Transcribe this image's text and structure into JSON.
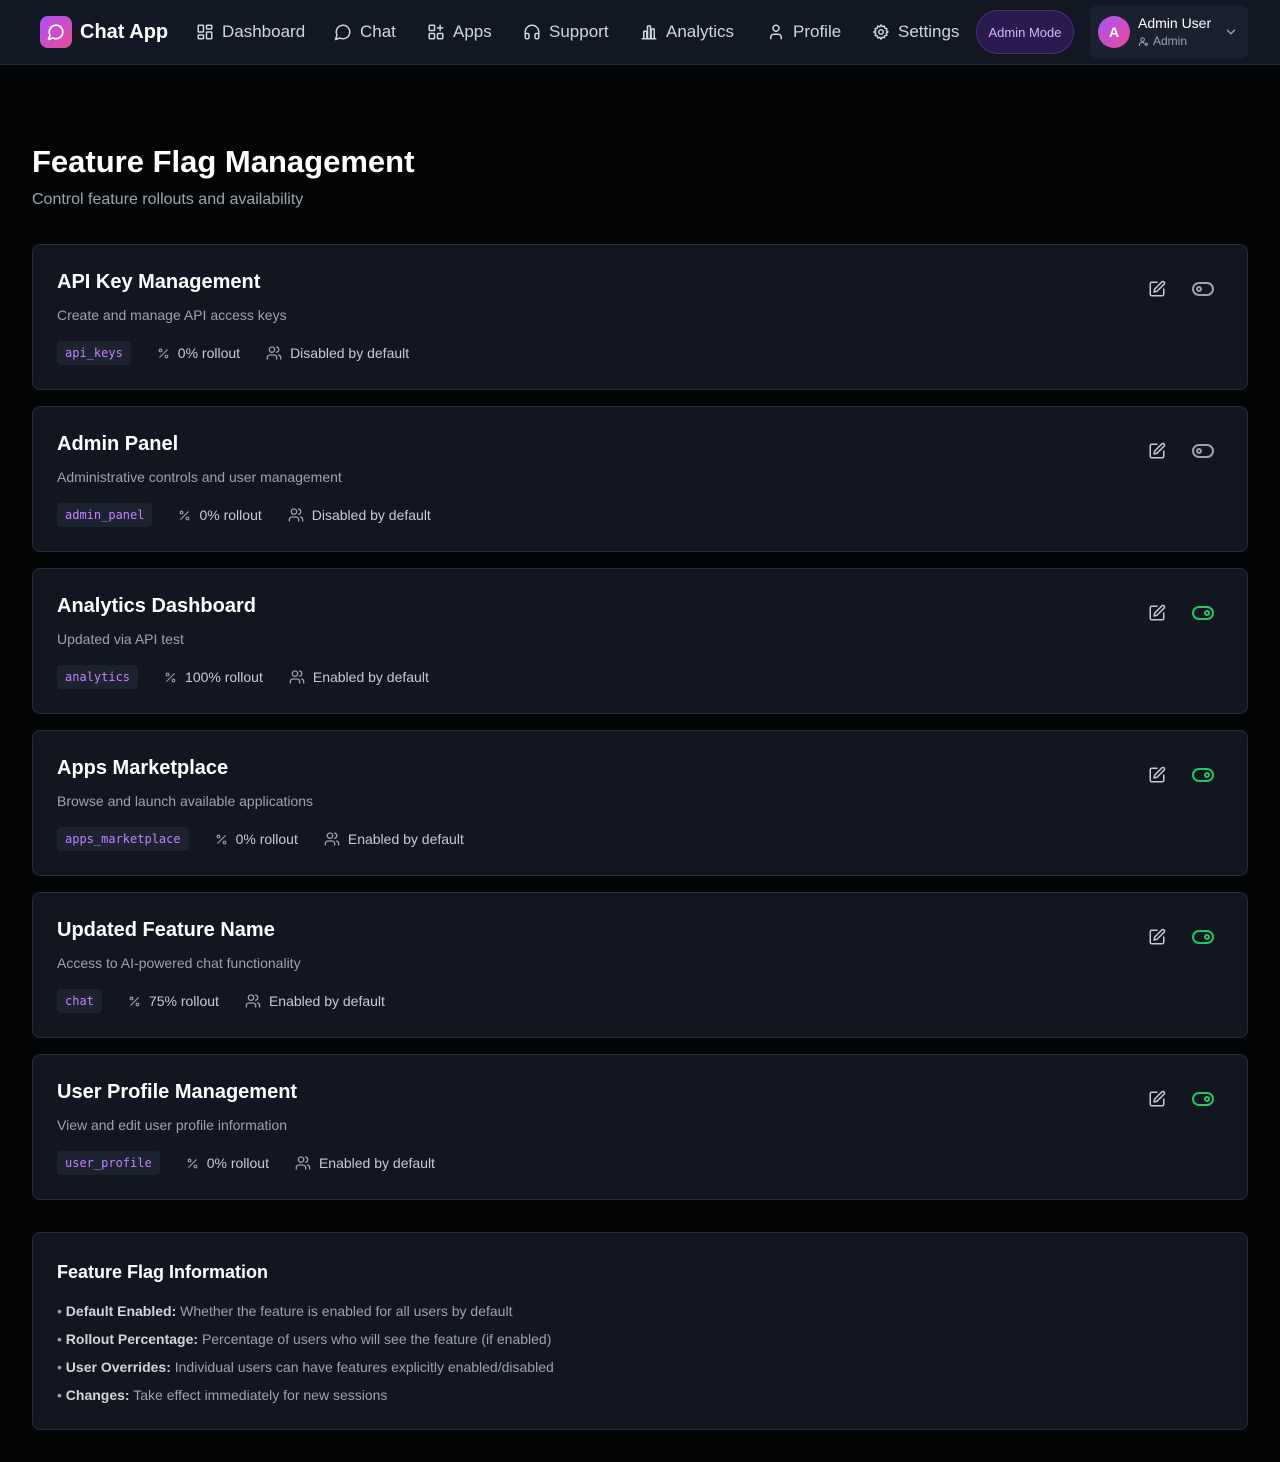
{
  "app": {
    "name": "Chat App",
    "admin_mode_label": "Admin Mode"
  },
  "nav": {
    "items": [
      {
        "label": "Dashboard",
        "icon": "dashboard-grid-icon"
      },
      {
        "label": "Chat",
        "icon": "chat-bubble-icon"
      },
      {
        "label": "Apps",
        "icon": "apps-icon"
      },
      {
        "label": "Support",
        "icon": "headset-icon"
      },
      {
        "label": "Analytics",
        "icon": "bar-chart-icon"
      },
      {
        "label": "Profile",
        "icon": "user-icon"
      },
      {
        "label": "Settings",
        "icon": "gear-icon"
      }
    ]
  },
  "user": {
    "initial": "A",
    "name": "Admin User",
    "role": "Admin"
  },
  "page": {
    "title": "Feature Flag Management",
    "subtitle": "Control feature rollouts and availability"
  },
  "flags": [
    {
      "name": "API Key Management",
      "description": "Create and manage API access keys",
      "key": "api_keys",
      "rollout": "0% rollout",
      "default": "Disabled by default",
      "enabled": false
    },
    {
      "name": "Admin Panel",
      "description": "Administrative controls and user management",
      "key": "admin_panel",
      "rollout": "0% rollout",
      "default": "Disabled by default",
      "enabled": false
    },
    {
      "name": "Analytics Dashboard",
      "description": "Updated via API test",
      "key": "analytics",
      "rollout": "100% rollout",
      "default": "Enabled by default",
      "enabled": true
    },
    {
      "name": "Apps Marketplace",
      "description": "Browse and launch available applications",
      "key": "apps_marketplace",
      "rollout": "0% rollout",
      "default": "Enabled by default",
      "enabled": true
    },
    {
      "name": "Updated Feature Name",
      "description": "Access to AI-powered chat functionality",
      "key": "chat",
      "rollout": "75% rollout",
      "default": "Enabled by default",
      "enabled": true
    },
    {
      "name": "User Profile Management",
      "description": "View and edit user profile information",
      "key": "user_profile",
      "rollout": "0% rollout",
      "default": "Enabled by default",
      "enabled": true
    }
  ],
  "info": {
    "title": "Feature Flag Information",
    "items": [
      {
        "term": "Default Enabled:",
        "text": "Whether the feature is enabled for all users by default"
      },
      {
        "term": "Rollout Percentage:",
        "text": "Percentage of users who will see the feature (if enabled)"
      },
      {
        "term": "User Overrides:",
        "text": "Individual users can have features explicitly enabled/disabled"
      },
      {
        "term": "Changes:",
        "text": "Take effect immediately for new sessions"
      }
    ]
  },
  "colors": {
    "accent": "#a855f7",
    "accent_pink": "#ec4899",
    "toggle_on": "#22c55e",
    "toggle_off": "#9ca3af",
    "key_text": "#c084fc"
  }
}
